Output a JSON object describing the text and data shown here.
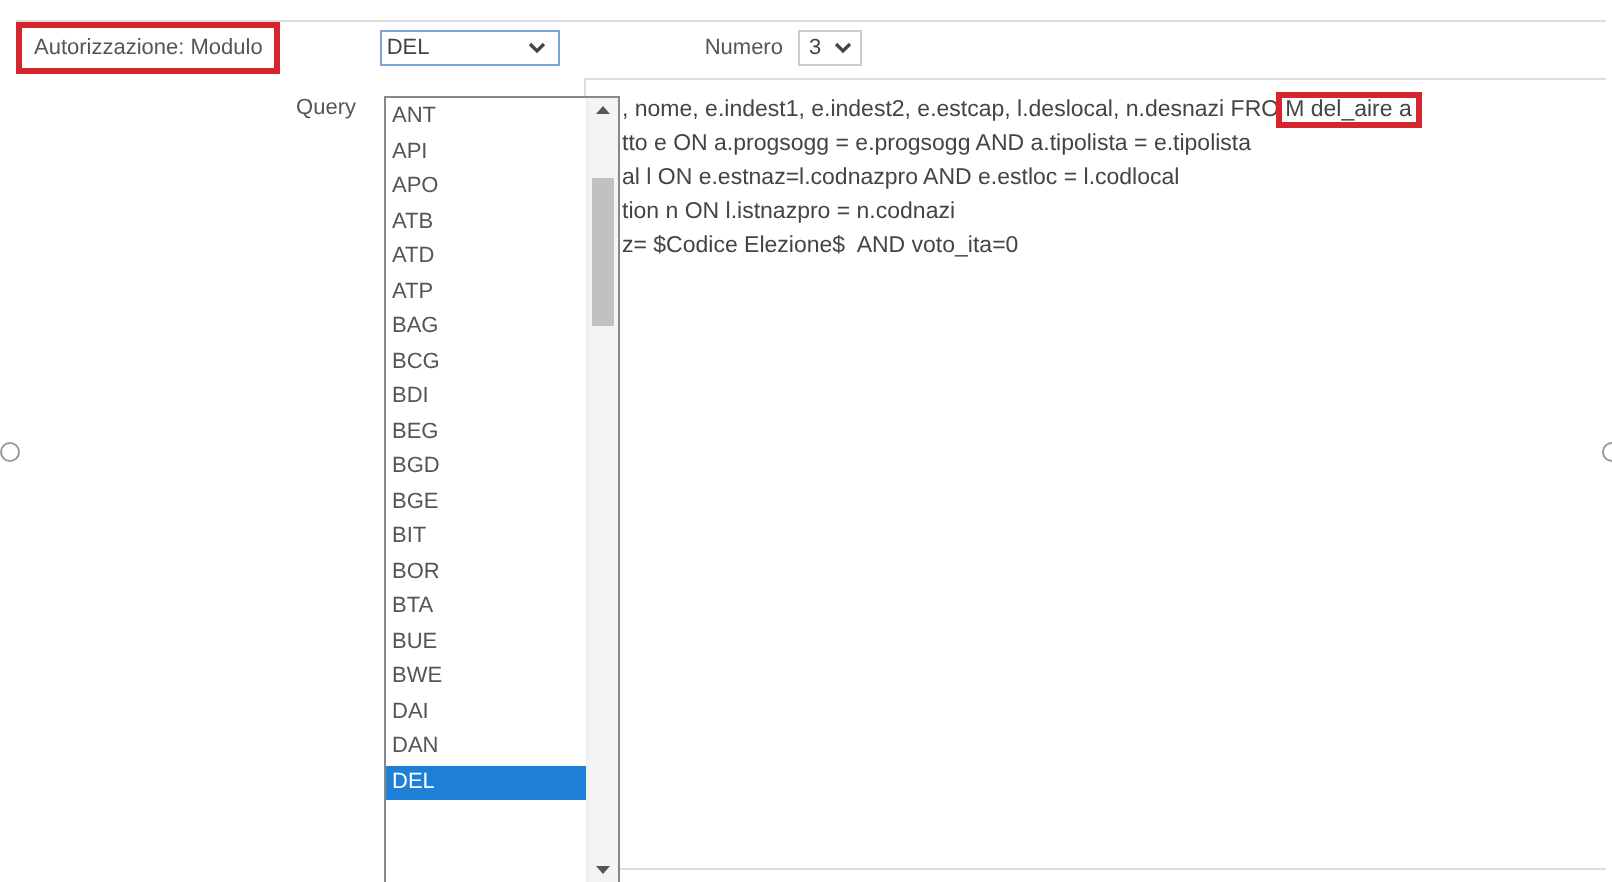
{
  "authorization": {
    "label": "Autorizzazione: Modulo",
    "highlighted": true
  },
  "module_select": {
    "value": "DEL",
    "expanded": true,
    "options": [
      {
        "label": "ANT",
        "selected": false
      },
      {
        "label": "API",
        "selected": false
      },
      {
        "label": "APO",
        "selected": false
      },
      {
        "label": "ATB",
        "selected": false
      },
      {
        "label": "ATD",
        "selected": false
      },
      {
        "label": "ATP",
        "selected": false
      },
      {
        "label": "BAG",
        "selected": false
      },
      {
        "label": "BCG",
        "selected": false
      },
      {
        "label": "BDI",
        "selected": false
      },
      {
        "label": "BEG",
        "selected": false
      },
      {
        "label": "BGD",
        "selected": false
      },
      {
        "label": "BGE",
        "selected": false
      },
      {
        "label": "BIT",
        "selected": false
      },
      {
        "label": "BOR",
        "selected": false
      },
      {
        "label": "BTA",
        "selected": false
      },
      {
        "label": "BUE",
        "selected": false
      },
      {
        "label": "BWE",
        "selected": false
      },
      {
        "label": "DAI",
        "selected": false
      },
      {
        "label": "DAN",
        "selected": false
      },
      {
        "label": "DEL",
        "selected": true
      }
    ]
  },
  "number": {
    "label": "Numero",
    "value": "3"
  },
  "query": {
    "label": "Query",
    "lines": [
      {
        "text": ", nome, e.indest1, e.indest2, e.estcap, l.deslocal, n.desnazi FRO",
        "highlight": "M del_aire a"
      },
      {
        "text": "tto e ON a.progsogg = e.progsogg AND a.tipolista = e.tipolista"
      },
      {
        "text": "al l ON e.estnaz=l.codnazpro AND e.estloc = l.codlocal"
      },
      {
        "text": "tion n ON l.istnazpro = n.codnazi"
      },
      {
        "text": "z= $Codice Elezione$  AND voto_ita=0"
      }
    ]
  }
}
